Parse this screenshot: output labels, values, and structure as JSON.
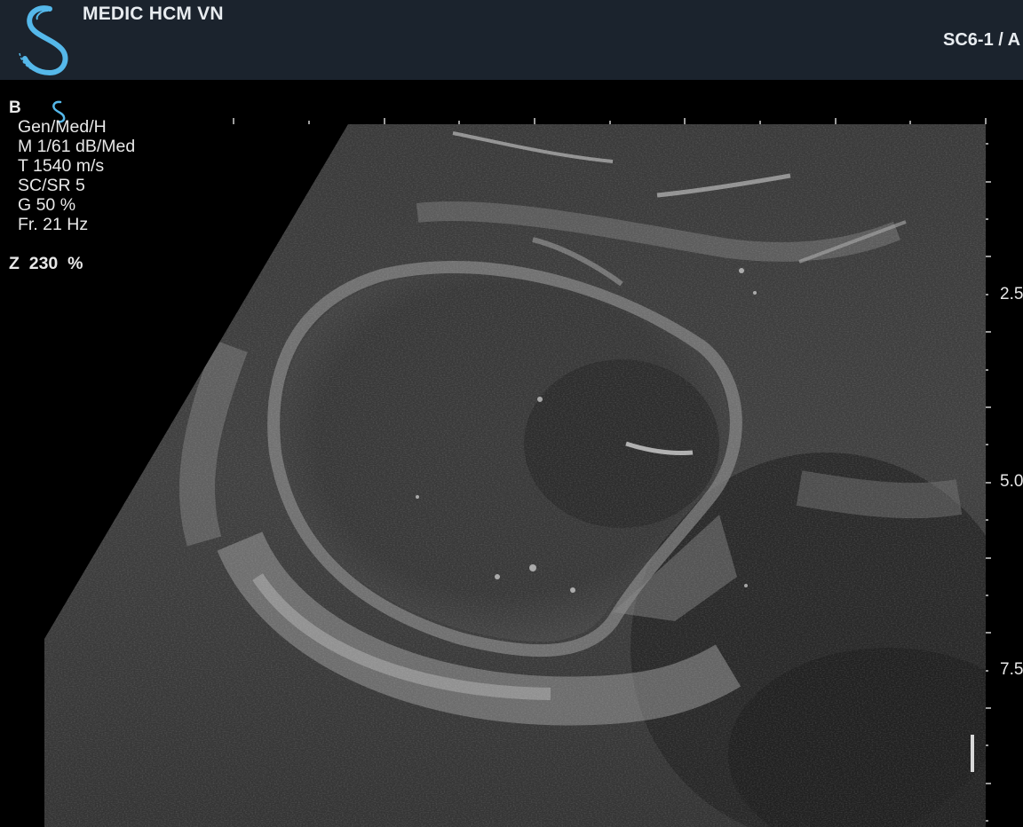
{
  "header": {
    "institution": "MEDIC HCM VN",
    "probe_preset": "SC6-1 / A",
    "logo_icon": "brand-s-logo-icon",
    "logo_color": "#55b8ea",
    "background": "#1b232d"
  },
  "overlay": {
    "mode": "B",
    "mini_logo_icon": "brand-s-mini-icon",
    "params": [
      "Gen/Med/H",
      "M 1/61 dB/Med",
      "T 1540 m/s",
      "SC/SR 5",
      "G 50 %",
      "Fr. 21 Hz"
    ],
    "zoom": "Z  230  %"
  },
  "depth_scale": {
    "labels": [
      "2.5",
      "5.0",
      "7.5"
    ]
  },
  "image": {
    "type": "ultrasound-b-mode",
    "background": "#000000"
  }
}
